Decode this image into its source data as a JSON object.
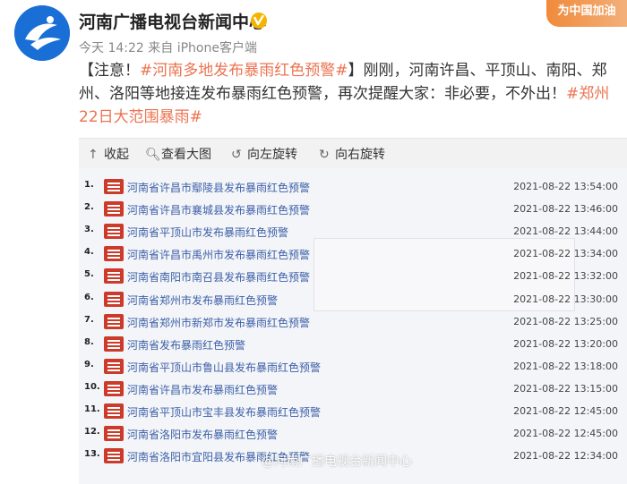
{
  "user": {
    "name": "河南广播电视台新闻中心",
    "verified_icon": "verified-badge-icon",
    "meta_time": "今天 14:22",
    "meta_source": "来自 iPhone客户端",
    "badge_text": "为中国加油"
  },
  "post": {
    "prefix": "【注意！",
    "tag1": "#河南多地发布暴雨红色预警#",
    "body": "】刚刚，河南许昌、平顶山、南阳、郑州、洛阳等地接连发布暴雨红色预警，再次提醒大家：非必要，不外出！",
    "tag2": "#郑州22日大范围暴雨#"
  },
  "toolbar": {
    "collapse": "收起",
    "view_large": "查看大图",
    "rotate_left": "向左旋转",
    "rotate_right": "向右旋转"
  },
  "alerts": [
    {
      "index": "1.",
      "title": "河南省许昌市鄢陵县发布暴雨红色预警",
      "time": "2021-08-22 13:54:00"
    },
    {
      "index": "2.",
      "title": "河南省许昌市襄城县发布暴雨红色预警",
      "time": "2021-08-22 13:46:00"
    },
    {
      "index": "3.",
      "title": "河南省平顶山市发布暴雨红色预警",
      "time": "2021-08-22 13:44:00"
    },
    {
      "index": "4.",
      "title": "河南省许昌市禹州市发布暴雨红色预警",
      "time": "2021-08-22 13:34:00"
    },
    {
      "index": "5.",
      "title": "河南省南阳市南召县发布暴雨红色预警",
      "time": "2021-08-22 13:32:00"
    },
    {
      "index": "6.",
      "title": "河南省郑州市发布暴雨红色预警",
      "time": "2021-08-22 13:30:00"
    },
    {
      "index": "7.",
      "title": "河南省郑州市新郑市发布暴雨红色预警",
      "time": "2021-08-22 13:25:00"
    },
    {
      "index": "8.",
      "title": "河南省发布暴雨红色预警",
      "time": "2021-08-22 13:20:00"
    },
    {
      "index": "9.",
      "title": "河南省平顶山市鲁山县发布暴雨红色预警",
      "time": "2021-08-22 13:18:00"
    },
    {
      "index": "10.",
      "title": "河南省许昌市发布暴雨红色预警",
      "time": "2021-08-22 13:15:00"
    },
    {
      "index": "11.",
      "title": "河南省平顶山市宝丰县发布暴雨红色预警",
      "time": "2021-08-22 12:45:00"
    },
    {
      "index": "12.",
      "title": "河南省洛阳市发布暴雨红色预警",
      "time": "2021-08-22 12:45:00"
    },
    {
      "index": "13.",
      "title": "河南省洛阳市宜阳县发布暴雨红色预警",
      "time": "2021-08-22 12:34:00"
    }
  ],
  "watermark": "@河南广播电视台新闻中心",
  "colors": {
    "tag": "#eb7350",
    "link": "#3b5fa8",
    "alert_icon": "#cc3a2a"
  }
}
